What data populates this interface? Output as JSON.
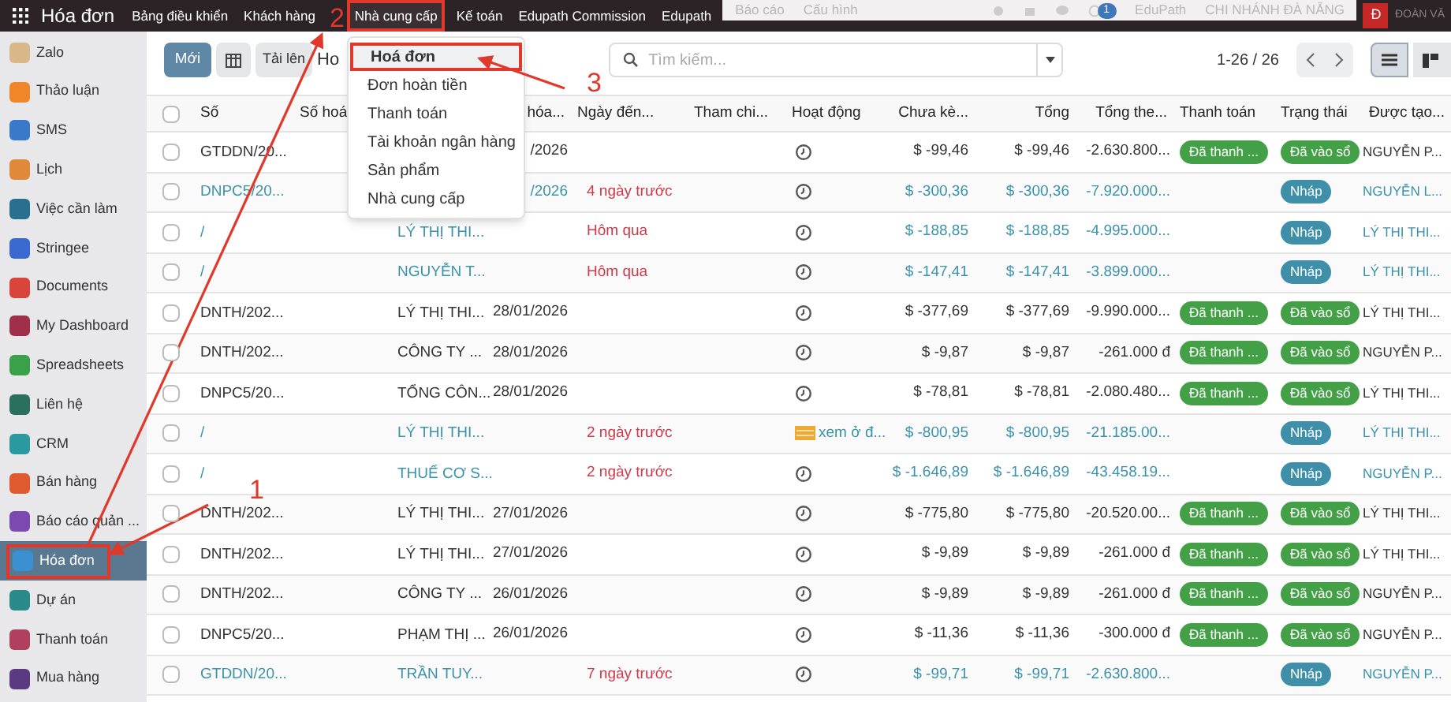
{
  "navbar": {
    "app_title": "Hóa đơn",
    "menu": [
      {
        "label": "Bảng điều khiển",
        "highlighted": false
      },
      {
        "label": "Khách hàng",
        "highlighted": false
      },
      {
        "label": "Nhà cung cấp",
        "highlighted": true
      },
      {
        "label": "Kế toán",
        "highlighted": false
      },
      {
        "label": "Edupath Commission",
        "highlighted": false
      },
      {
        "label": "Edupath",
        "highlighted": false
      }
    ],
    "faded_menu": [
      "Báo cáo",
      "Cấu hình"
    ],
    "badge": "1",
    "company": "EduPath",
    "branch": "CHI NHÁNH ĐÀ NẴNG",
    "avatar": "Đ",
    "user": "ĐOÀN VĂ"
  },
  "dropdown": [
    {
      "label": "Hoá đơn",
      "highlighted": true
    },
    {
      "label": "Đơn hoàn tiền",
      "highlighted": false
    },
    {
      "label": "Thanh toán",
      "highlighted": false
    },
    {
      "label": "Tài khoản ngân hàng",
      "highlighted": false
    },
    {
      "label": "Sản phẩm",
      "highlighted": false
    },
    {
      "label": "Nhà cung cấp",
      "highlighted": false
    }
  ],
  "sidebar": [
    {
      "label": "Zalo",
      "color": "#d8b888",
      "selected": false,
      "highlighted": false
    },
    {
      "label": "Thảo luận",
      "color": "#f0862a",
      "selected": false,
      "highlighted": false
    },
    {
      "label": "SMS",
      "color": "#3a78c9",
      "selected": false,
      "highlighted": false
    },
    {
      "label": "Lịch",
      "color": "#e0893a",
      "selected": false,
      "highlighted": false
    },
    {
      "label": "Việc cần làm",
      "color": "#2a6f8f",
      "selected": false,
      "highlighted": false
    },
    {
      "label": "Stringee",
      "color": "#3a6ad0",
      "selected": false,
      "highlighted": false
    },
    {
      "label": "Documents",
      "color": "#d9453a",
      "selected": false,
      "highlighted": false
    },
    {
      "label": "My Dashboard",
      "color": "#a0304a",
      "selected": false,
      "highlighted": false
    },
    {
      "label": "Spreadsheets",
      "color": "#3aa04a",
      "selected": false,
      "highlighted": false
    },
    {
      "label": "Liên hệ",
      "color": "#2b6f5f",
      "selected": false,
      "highlighted": false
    },
    {
      "label": "CRM",
      "color": "#2a9aa0",
      "selected": false,
      "highlighted": false
    },
    {
      "label": "Bán hàng",
      "color": "#e05a30",
      "selected": false,
      "highlighted": false
    },
    {
      "label": "Báo cáo quản ...",
      "color": "#7a4ab0",
      "selected": false,
      "highlighted": false
    },
    {
      "label": "Hóa đơn",
      "color": "#3a90d0",
      "selected": true,
      "highlighted": true
    },
    {
      "label": "Dự án",
      "color": "#2a8a8a",
      "selected": false,
      "highlighted": false
    },
    {
      "label": "Thanh toán",
      "color": "#b04060",
      "selected": false,
      "highlighted": false
    },
    {
      "label": "Mua hàng",
      "color": "#5a3a80",
      "selected": false,
      "highlighted": false
    }
  ],
  "control_panel": {
    "new_button": "Mới",
    "upload_button": "Tải lên",
    "breadcrumb": "Ho",
    "search": {
      "placeholder": "Tìm kiếm..."
    },
    "pager": "1-26 / 26"
  },
  "table": {
    "select_all_checked": false,
    "columns": [
      "Số",
      "Số hoá",
      "hóa...",
      "Ngày đến...",
      "Tham chi...",
      "Hoạt động",
      "Chưa kè...",
      "Tổng",
      "Tổng the...",
      "Thanh toán",
      "Trạng thái",
      "Được tạo..."
    ],
    "rows": [
      {
        "checked": false,
        "number": "GTDDN/20...",
        "date": "/2026",
        "activity": {
          "kind": "clock"
        },
        "untaxed": "$ -99,46",
        "total": "$ -99,46",
        "total_currency": "-2.630.800...",
        "payment": "Đã thanh ...",
        "status": {
          "kind": "posted",
          "label": "Đã vào sổ"
        },
        "created_by": "NGUYỄN P..."
      },
      {
        "checked": false,
        "number": "DNPC5/20...",
        "date": "/2026",
        "due": "4 ngày trước",
        "activity": {
          "kind": "clock"
        },
        "untaxed": "$ -300,36",
        "total": "$ -300,36",
        "total_currency": "-7.920.000...",
        "status": {
          "kind": "draft",
          "label": "Nháp"
        },
        "created_by": "NGUYỄN L..."
      },
      {
        "checked": false,
        "number": "/",
        "partner": "LÝ THỊ THI...",
        "due": "Hôm qua",
        "activity": {
          "kind": "clock"
        },
        "untaxed": "$ -188,85",
        "total": "$ -188,85",
        "total_currency": "-4.995.000...",
        "status": {
          "kind": "draft",
          "label": "Nháp"
        },
        "created_by": "LÝ THỊ THI..."
      },
      {
        "checked": false,
        "number": "/",
        "partner": "NGUYỄN T...",
        "due": "Hôm qua",
        "activity": {
          "kind": "clock"
        },
        "untaxed": "$ -147,41",
        "total": "$ -147,41",
        "total_currency": "-3.899.000...",
        "status": {
          "kind": "draft",
          "label": "Nháp"
        },
        "created_by": "LÝ THỊ THI..."
      },
      {
        "checked": false,
        "number": "DNTH/202...",
        "partner": "LÝ THỊ THI...",
        "date": "28/01/2026",
        "activity": {
          "kind": "clock"
        },
        "untaxed": "$ -377,69",
        "total": "$ -377,69",
        "total_currency": "-9.990.000...",
        "payment": "Đã thanh ...",
        "status": {
          "kind": "posted",
          "label": "Đã vào sổ"
        },
        "created_by": "LÝ THỊ THI..."
      },
      {
        "checked": false,
        "number": "DNTH/202...",
        "partner": "CÔNG TY ...",
        "date": "28/01/2026",
        "activity": {
          "kind": "clock"
        },
        "untaxed": "$ -9,87",
        "total": "$ -9,87",
        "total_currency": "-261.000 đ",
        "payment": "Đã thanh ...",
        "status": {
          "kind": "posted",
          "label": "Đã vào sổ"
        },
        "created_by": "NGUYỄN P..."
      },
      {
        "checked": false,
        "number": "DNPC5/20...",
        "partner": "TỔNG CÔN...",
        "date": "28/01/2026",
        "activity": {
          "kind": "clock"
        },
        "untaxed": "$ -78,81",
        "total": "$ -78,81",
        "total_currency": "-2.080.480...",
        "payment": "Đã thanh ...",
        "status": {
          "kind": "posted",
          "label": "Đã vào sổ"
        },
        "created_by": "LÝ THỊ THI..."
      },
      {
        "checked": false,
        "number": "/",
        "partner": "LÝ THỊ THI...",
        "due": "2 ngày trước",
        "activity": {
          "kind": "note",
          "label": "xem ở đ..."
        },
        "untaxed": "$ -800,95",
        "total": "$ -800,95",
        "total_currency": "-21.185.00...",
        "status": {
          "kind": "draft",
          "label": "Nháp"
        },
        "created_by": "LÝ THỊ THI..."
      },
      {
        "checked": false,
        "number": "/",
        "partner": "THUẾ CƠ S...",
        "due": "2 ngày trước",
        "activity": {
          "kind": "clock"
        },
        "untaxed": "$ -1.646,89",
        "total": "$ -1.646,89",
        "total_currency": "-43.458.19...",
        "status": {
          "kind": "draft",
          "label": "Nháp"
        },
        "created_by": "NGUYỄN P..."
      },
      {
        "checked": false,
        "number": "DNTH/202...",
        "partner": "LÝ THỊ THI...",
        "date": "27/01/2026",
        "activity": {
          "kind": "clock"
        },
        "untaxed": "$ -775,80",
        "total": "$ -775,80",
        "total_currency": "-20.520.00...",
        "payment": "Đã thanh ...",
        "status": {
          "kind": "posted",
          "label": "Đã vào sổ"
        },
        "created_by": "LÝ THỊ THI..."
      },
      {
        "checked": false,
        "number": "DNTH/202...",
        "partner": "LÝ THỊ THI...",
        "date": "27/01/2026",
        "activity": {
          "kind": "clock"
        },
        "untaxed": "$ -9,89",
        "total": "$ -9,89",
        "total_currency": "-261.000 đ",
        "payment": "Đã thanh ...",
        "status": {
          "kind": "posted",
          "label": "Đã vào sổ"
        },
        "created_by": "LÝ THỊ THI..."
      },
      {
        "checked": false,
        "number": "DNTH/202...",
        "partner": "CÔNG TY ...",
        "date": "26/01/2026",
        "activity": {
          "kind": "clock"
        },
        "untaxed": "$ -9,89",
        "total": "$ -9,89",
        "total_currency": "-261.000 đ",
        "payment": "Đã thanh ...",
        "status": {
          "kind": "posted",
          "label": "Đã vào sổ"
        },
        "created_by": "NGUYỄN P..."
      },
      {
        "checked": false,
        "number": "DNPC5/20...",
        "partner": "PHẠM THỊ ...",
        "date": "26/01/2026",
        "activity": {
          "kind": "clock"
        },
        "untaxed": "$ -11,36",
        "total": "$ -11,36",
        "total_currency": "-300.000 đ",
        "payment": "Đã thanh ...",
        "status": {
          "kind": "posted",
          "label": "Đã vào sổ"
        },
        "created_by": "NGUYỄN P..."
      },
      {
        "checked": false,
        "number": "GTDDN/20...",
        "partner": "TRẦN TUY...",
        "due": "7 ngày trước",
        "activity": {
          "kind": "clock"
        },
        "untaxed": "$ -99,71",
        "total": "$ -99,71",
        "total_currency": "-2.630.800...",
        "status": {
          "kind": "draft",
          "label": "Nháp"
        },
        "created_by": "NGUYỄN P..."
      }
    ]
  },
  "annotations": [
    {
      "label": "1"
    },
    {
      "label": "2"
    },
    {
      "label": "3"
    }
  ]
}
